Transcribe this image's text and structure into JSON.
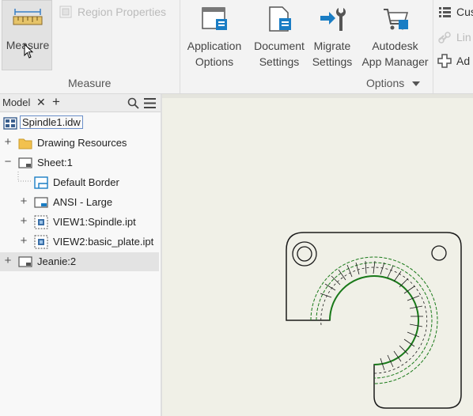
{
  "ribbon": {
    "measure": {
      "label": "Measure",
      "group_label": "Measure"
    },
    "region_properties": "Region Properties",
    "buttons": [
      {
        "label": "Application\nOptions"
      },
      {
        "label": "Document\nSettings"
      },
      {
        "label": "Migrate\nSettings"
      },
      {
        "label": "Autodesk\nApp Manager"
      }
    ],
    "options_group_label": "Options",
    "side_items": [
      "Cus",
      "Lin",
      "Ad"
    ]
  },
  "browser": {
    "tab_label": "Model",
    "tree": [
      {
        "label": "Spindle1.idw"
      },
      {
        "label": "Drawing Resources"
      },
      {
        "label": "Sheet:1"
      },
      {
        "label": "Default Border"
      },
      {
        "label": "ANSI - Large"
      },
      {
        "label": "VIEW1:Spindle.ipt"
      },
      {
        "label": "VIEW2:basic_plate.ipt"
      },
      {
        "label": "Jeanie:2"
      }
    ]
  },
  "colors": {
    "accent_blue": "#1a7dc4",
    "part_edge": "#1a1a1a",
    "hatch_green": "#1a7a1a",
    "canvas_bg": "#f0f0e7"
  }
}
